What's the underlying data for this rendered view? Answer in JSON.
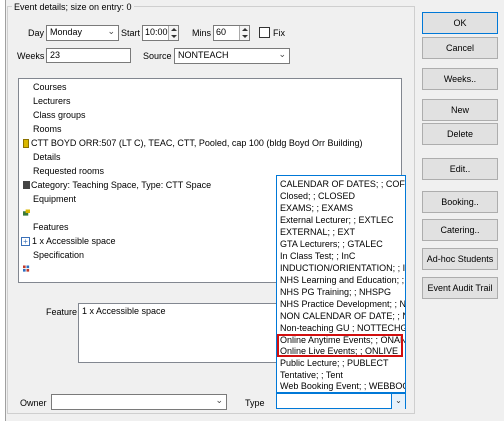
{
  "group_title": "Event details; size on entry: 0",
  "day": {
    "label": "Day",
    "value": "Monday"
  },
  "start": {
    "label": "Start",
    "value": "10:00"
  },
  "mins": {
    "label": "Mins",
    "value": "60"
  },
  "fix": {
    "label": "Fix",
    "checked": false
  },
  "weeks": {
    "label": "Weeks",
    "value": "23"
  },
  "source": {
    "label": "Source",
    "value": "NONTEACH"
  },
  "tree": [
    {
      "text": "Courses",
      "icon": "none"
    },
    {
      "text": "Lecturers",
      "icon": "none"
    },
    {
      "text": "Class groups",
      "icon": "none"
    },
    {
      "text": "Rooms",
      "icon": "none"
    },
    {
      "text": "CTT BOYD ORR:507 (LT C), TEAC, CTT, Pooled, cap 100 (bldg Boyd Orr Building)",
      "icon": "key-icon"
    },
    {
      "text": "Details",
      "icon": "none"
    },
    {
      "text": "Requested rooms",
      "icon": "none"
    },
    {
      "text": "Category: Teaching Space, Type: CTT Space",
      "icon": "book-icon"
    },
    {
      "text": "Equipment",
      "icon": "none"
    },
    {
      "text": "",
      "icon": "equipment-icon"
    },
    {
      "text": "Features",
      "icon": "none"
    },
    {
      "text": "1 x Accessible space",
      "icon": "expand-icon"
    },
    {
      "text": "Specification",
      "icon": "none"
    },
    {
      "text": "",
      "icon": "specification-icon"
    }
  ],
  "feature": {
    "label": "Feature",
    "value": "1 x Accessible space"
  },
  "owner": {
    "label": "Owner",
    "value": ""
  },
  "type": {
    "label": "Type",
    "value": ""
  },
  "type_options": [
    "CALENDAR OF DATES; ; COFD",
    "Closed; ; CLOSED",
    "EXAMS; ; EXAMS",
    "External Lecturer; ; EXTLEC",
    "EXTERNAL; ; EXT",
    "GTA Lecturers; ; GTALEC",
    "In Class Test; ; InC",
    "INDUCTION/ORIENTATION; ; INDU",
    "NHS Learning and Education; ; NHS",
    "NHS PG Training; ; NHSPG",
    "NHS Practice Development; ; NHSI",
    "NON CALENDAR OF DATE; ; NCO",
    "Non-teaching GU ; NOTTECHGU",
    "Online Anytime Events; ; ONANY",
    "Online Live Events; ; ONLIVE",
    "Public Lecture; ; PUBLECT",
    "Tentative; ; Tent",
    "Web Booking Event; ; WEBBOOK"
  ],
  "buttons": {
    "ok": "OK",
    "cancel": "Cancel",
    "weeks": "Weeks..",
    "new": "New",
    "delete": "Delete",
    "edit": "Edit..",
    "booking": "Booking..",
    "catering": "Catering..",
    "adhoc": "Ad-hoc Students",
    "audit": "Event Audit Trail"
  },
  "colors": {
    "highlight": "#d10f0f",
    "focus": "#0078d7"
  }
}
